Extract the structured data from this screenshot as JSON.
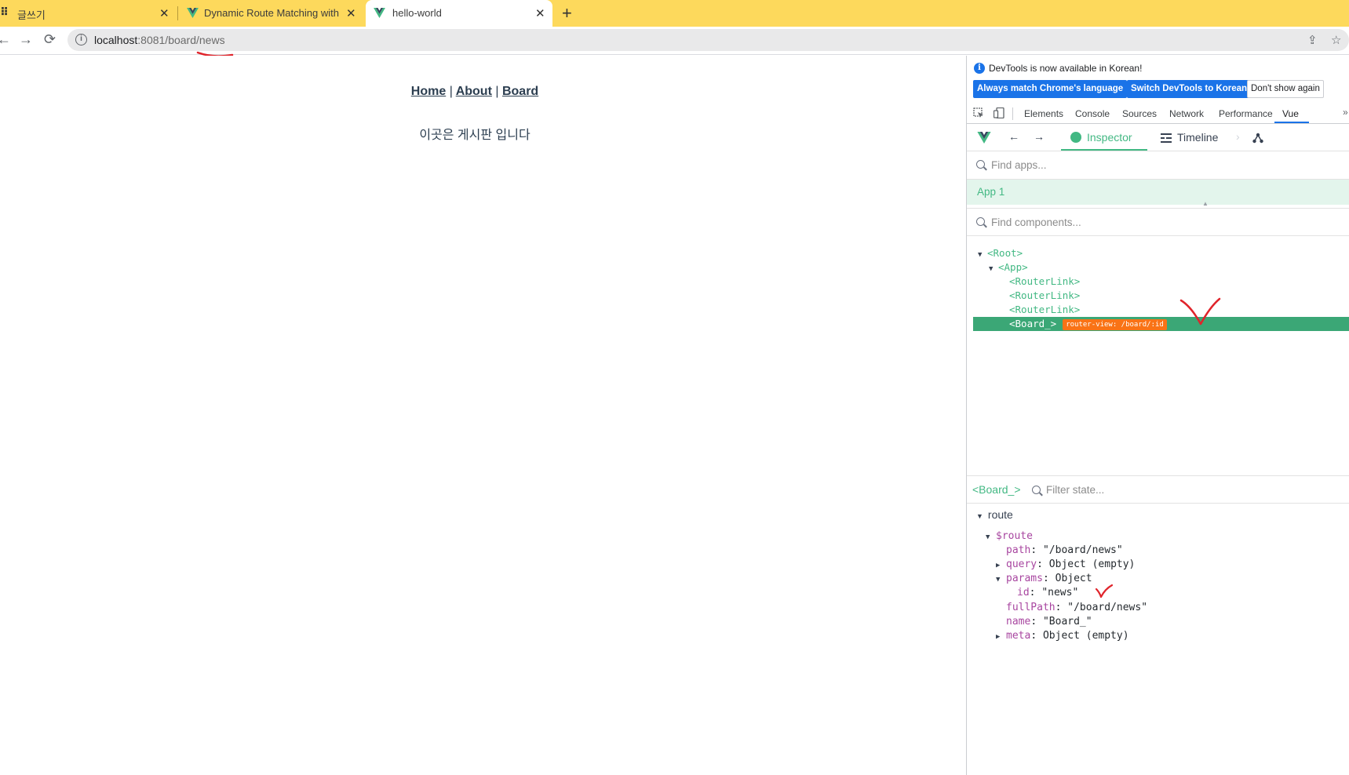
{
  "browser": {
    "tabs": [
      {
        "title": "글쓰기",
        "active": false
      },
      {
        "title": "Dynamic Route Matching with P",
        "active": false
      },
      {
        "title": "hello-world",
        "active": true
      }
    ],
    "url_host": "localhost",
    "url_port_path": ":8081/board/news",
    "close_glyph": "✕",
    "new_tab_glyph": "+"
  },
  "page": {
    "nav": {
      "home": "Home",
      "about": "About",
      "board": "Board",
      "separator": "|"
    },
    "board_message": "이곳은 게시판 입니다"
  },
  "devtools": {
    "banner": {
      "info": "i",
      "message": "DevTools is now available in Korean!",
      "btn_match": "Always match Chrome's language",
      "btn_switch": "Switch DevTools to Korean",
      "btn_dismiss": "Don't show again"
    },
    "tabs": [
      "Elements",
      "Console",
      "Sources",
      "Network",
      "Performance",
      "Vue"
    ],
    "active_tab": "Vue",
    "vue": {
      "inspector_label": "Inspector",
      "timeline_label": "Timeline",
      "find_apps_placeholder": "Find apps...",
      "app_name": "App 1",
      "find_components_placeholder": "Find components...",
      "tree": {
        "root": "<Root>",
        "app": "<App>",
        "router_link": "<RouterLink>",
        "board": "<Board_>",
        "route_badge": "router-view: /board/:id"
      },
      "state_component": "<Board_>",
      "filter_state_placeholder": "Filter state...",
      "state": {
        "section": "route",
        "route_key": "$route",
        "path_key": "path",
        "path_value": "\"/board/news\"",
        "query_key": "query",
        "query_value": "Object (empty)",
        "params_key": "params",
        "params_value": "Object",
        "id_key": "id",
        "id_value": "\"news\"",
        "fullpath_key": "fullPath",
        "fullpath_value": "\"/board/news\"",
        "name_key": "name",
        "name_value": "\"Board_\"",
        "meta_key": "meta",
        "meta_value": "Object (empty)"
      }
    }
  },
  "colors": {
    "tab_strip": "#fdd95c",
    "vue_green": "#42b883",
    "selected_row": "#3ba776",
    "badge": "#f97316",
    "annotation": "#e0242b",
    "chrome_blue": "#1a73e8"
  }
}
